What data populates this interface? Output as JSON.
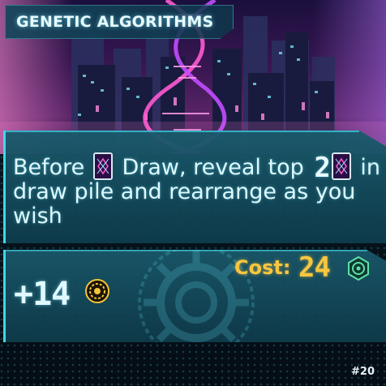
{
  "card": {
    "title": "GENETIC ALGORITHMS",
    "effect": {
      "part1": "Before",
      "part2": "Draw, reveal top",
      "count": "2",
      "part3": "in draw pile and rearrange as you wish"
    },
    "value": "+14",
    "cost_label": "Cost:",
    "cost_value": "24",
    "number": "#20"
  },
  "icons": {
    "draw_card": "card-back-icon",
    "value": "gold-gear-coin-icon",
    "cost": "green-hex-credit-icon"
  },
  "colors": {
    "accent": "#3fd8e8",
    "cost": "#f6c640",
    "text": "#dcf9ff",
    "panel": "#1a5a6c"
  }
}
